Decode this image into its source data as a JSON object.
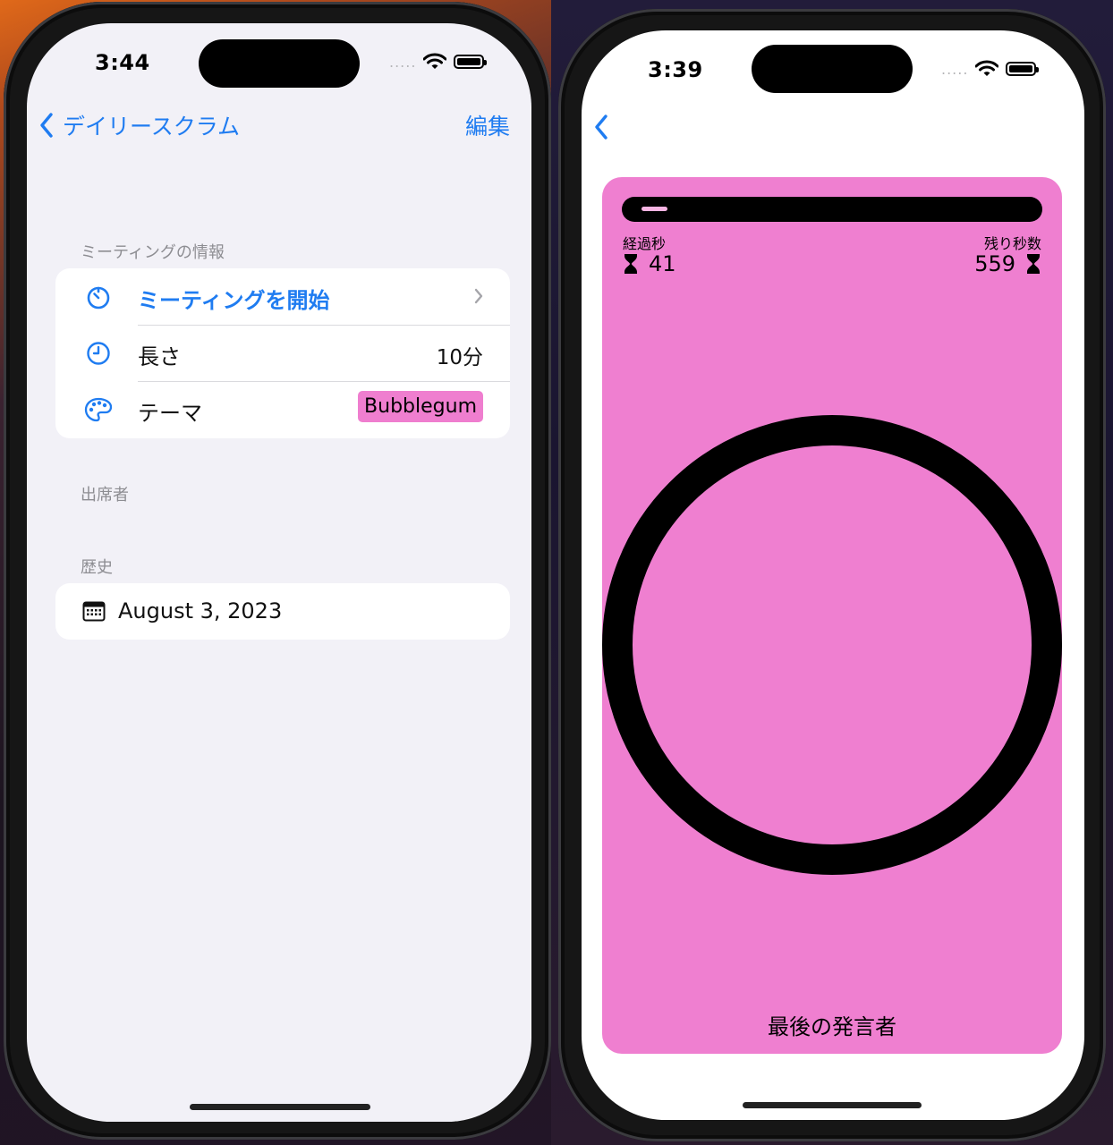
{
  "left_screen": {
    "status": {
      "time": "3:44",
      "signal": "....."
    },
    "nav": {
      "back_label": "デイリースクラム",
      "edit_label": "編集"
    },
    "meeting_info": {
      "header": "ミーティングの情報",
      "start_label": "ミーティングを開始",
      "length_label": "長さ",
      "length_value": "10分",
      "theme_label": "テーマ",
      "theme_value": "Bubblegum"
    },
    "attendees": {
      "header": "出席者"
    },
    "history": {
      "header": "歴史",
      "items": [
        "August 3, 2023"
      ]
    }
  },
  "right_screen": {
    "status": {
      "time": "3:39",
      "signal": "....."
    },
    "timer": {
      "elapsed_label": "経過秒",
      "elapsed_value": "41",
      "remaining_label": "残り秒数",
      "remaining_value": "559",
      "progress_fraction": 0.068,
      "speaker_label": "最後の発言者"
    }
  },
  "colors": {
    "accent": "#1f7cf1",
    "theme_bubblegum": "#ef7fd0",
    "list_background": "#f2f1f7"
  },
  "icons": [
    "chevron-left-icon",
    "timer-icon",
    "clock-icon",
    "palette-icon",
    "chevron-right-icon",
    "calendar-icon",
    "hourglass-icon",
    "wifi-icon",
    "battery-icon"
  ]
}
